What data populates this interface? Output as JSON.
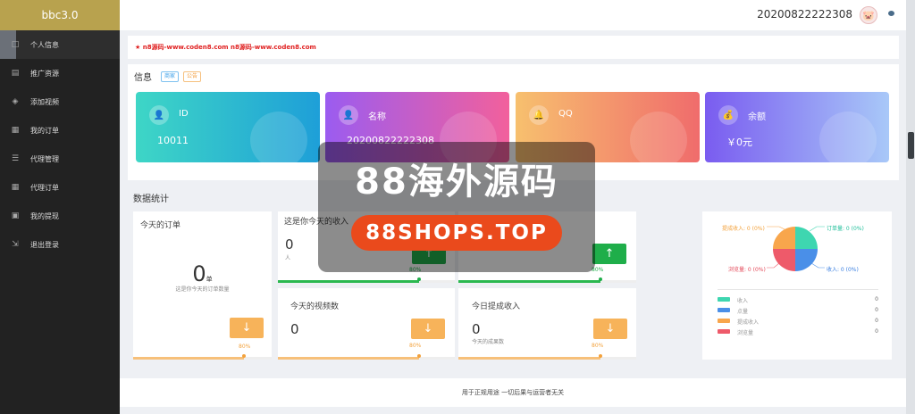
{
  "app": {
    "brand": "bbc3.0"
  },
  "header": {
    "username": "20200822222308"
  },
  "sidebar": {
    "items": [
      {
        "label": "个人信息",
        "icon": "□"
      },
      {
        "label": "推广资源",
        "icon": "▤"
      },
      {
        "label": "添加视频",
        "icon": "◈"
      },
      {
        "label": "我的订单",
        "icon": "▦"
      },
      {
        "label": "代理管理",
        "icon": "☰"
      },
      {
        "label": "代理订单",
        "icon": "▦"
      },
      {
        "label": "我的提现",
        "icon": "▣"
      },
      {
        "label": "退出登录",
        "icon": "⇲"
      }
    ]
  },
  "notice": {
    "text": "★ n8源码-www.coden8.com n8源码-www.coden8.com"
  },
  "info": {
    "title": "信息",
    "tag_blue": "商家",
    "tag_orange": "公告",
    "cards": [
      {
        "label": "ID",
        "value": "10011",
        "icon": "👤"
      },
      {
        "label": "名称",
        "value": "20200822222308",
        "icon": "👤"
      },
      {
        "label": "QQ",
        "value": "",
        "icon": "🔔"
      },
      {
        "label": "余额",
        "value": "￥0元",
        "icon": "💰"
      }
    ]
  },
  "stats": {
    "title": "数据统计",
    "today_orders": {
      "title": "今天的订单",
      "value": "0",
      "unit": "单",
      "desc": "这是你今天的订单数量",
      "pct": "80%",
      "btn": "↓"
    },
    "today_income": {
      "title": "这是你今天的收入",
      "value": "0",
      "sub": "人",
      "pct": "80%",
      "btn": "↑"
    },
    "hidden_card": {
      "pct": "80%",
      "btn": "↑"
    },
    "today_videos": {
      "title": "今天的视频数",
      "value": "0",
      "pct": "80%",
      "btn": "↓"
    },
    "today_commission": {
      "title": "今日提成收入",
      "value": "0",
      "sub": "今天的成果数",
      "pct": "80%",
      "btn": "↓"
    }
  },
  "pie": {
    "labels": {
      "tl": "提成收入: 0 (0%)",
      "tr": "订单量: 0 (0%)",
      "bl": "浏览量: 0 (0%)",
      "br": "收入: 0 (0%)"
    },
    "legend": [
      {
        "name": "收入",
        "value": "0",
        "color": "#3ed6b0"
      },
      {
        "name": "点量",
        "value": "0",
        "color": "#4a8fe8"
      },
      {
        "name": "提成收入",
        "value": "0",
        "color": "#f8a64c"
      },
      {
        "name": "浏览量",
        "value": "0",
        "color": "#ee5a6a"
      }
    ]
  },
  "footer": {
    "text": "用于正规用途 一切后果与运营者无关"
  },
  "watermark": {
    "title": "88海外源码",
    "domain": "88SHOPS.TOP"
  },
  "colors": {
    "green_btn": "#1fae4a",
    "orange_btn": "#f7b35a",
    "green_bar": "#2bb84f",
    "orange_bar": "#f7c07a"
  }
}
